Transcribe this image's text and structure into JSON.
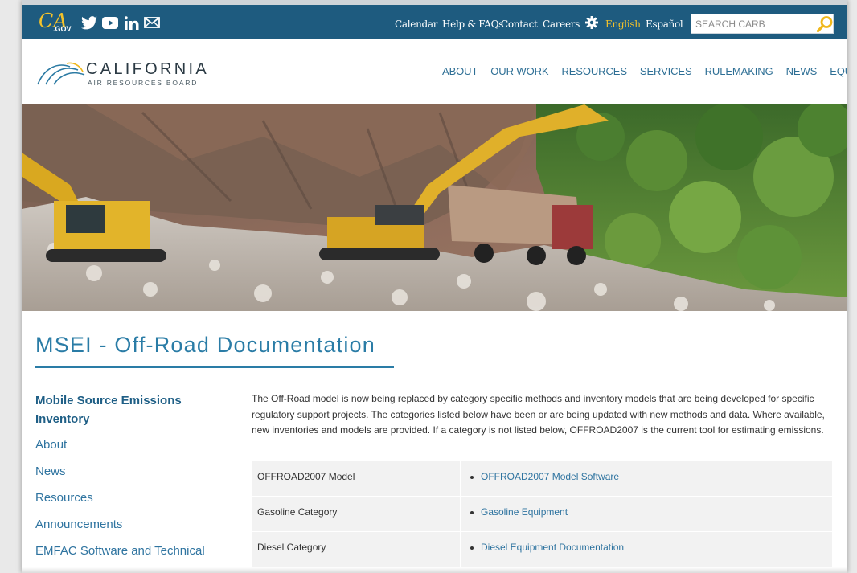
{
  "utility_bar": {
    "ca_logo_mark": "CA",
    "ca_logo_suffix": ".GOV",
    "social_icons": [
      "twitter-icon",
      "youtube-icon",
      "linkedin-icon",
      "mail-icon"
    ],
    "links": [
      "Calendar",
      "Help & FAQs",
      "Contact",
      "Careers"
    ],
    "language_english": "English",
    "language_spanish": "Español",
    "search_placeholder": "SEARCH CARB",
    "accent_color": "#f3c22b",
    "bar_color": "#1e5b7f"
  },
  "header": {
    "logo_name": "CALIFORNIA",
    "logo_subtitle": "AIR RESOURCES BOARD",
    "nav": [
      "ABOUT",
      "OUR WORK",
      "RESOURCES",
      "SERVICES",
      "RULEMAKING",
      "NEWS",
      "EQUITY"
    ]
  },
  "page": {
    "title": "MSEI - Off-Road Documentation"
  },
  "sidebar": {
    "heading": "Mobile Source Emissions Inventory",
    "items": [
      "About",
      "News",
      "Resources",
      "Announcements",
      "EMFAC Software and Technical"
    ]
  },
  "content": {
    "intro_before_link": "The Off-Road model is now being ",
    "intro_link": "replaced",
    "intro_after_link": " by category specific methods and inventory models that are being developed for specific regulatory support projects. The categories listed below have been or are being updated with new methods and data. Where available, new inventories and models are provided. If a category is not listed below, OFFROAD2007 is the current tool for estimating emissions.",
    "rows": [
      {
        "category": "OFFROAD2007 Model",
        "link": "OFFROAD2007 Model Software"
      },
      {
        "category": "Gasoline Category",
        "link": "Gasoline Equipment"
      },
      {
        "category": "Diesel Category",
        "link": "Diesel Equipment Documentation"
      }
    ]
  }
}
